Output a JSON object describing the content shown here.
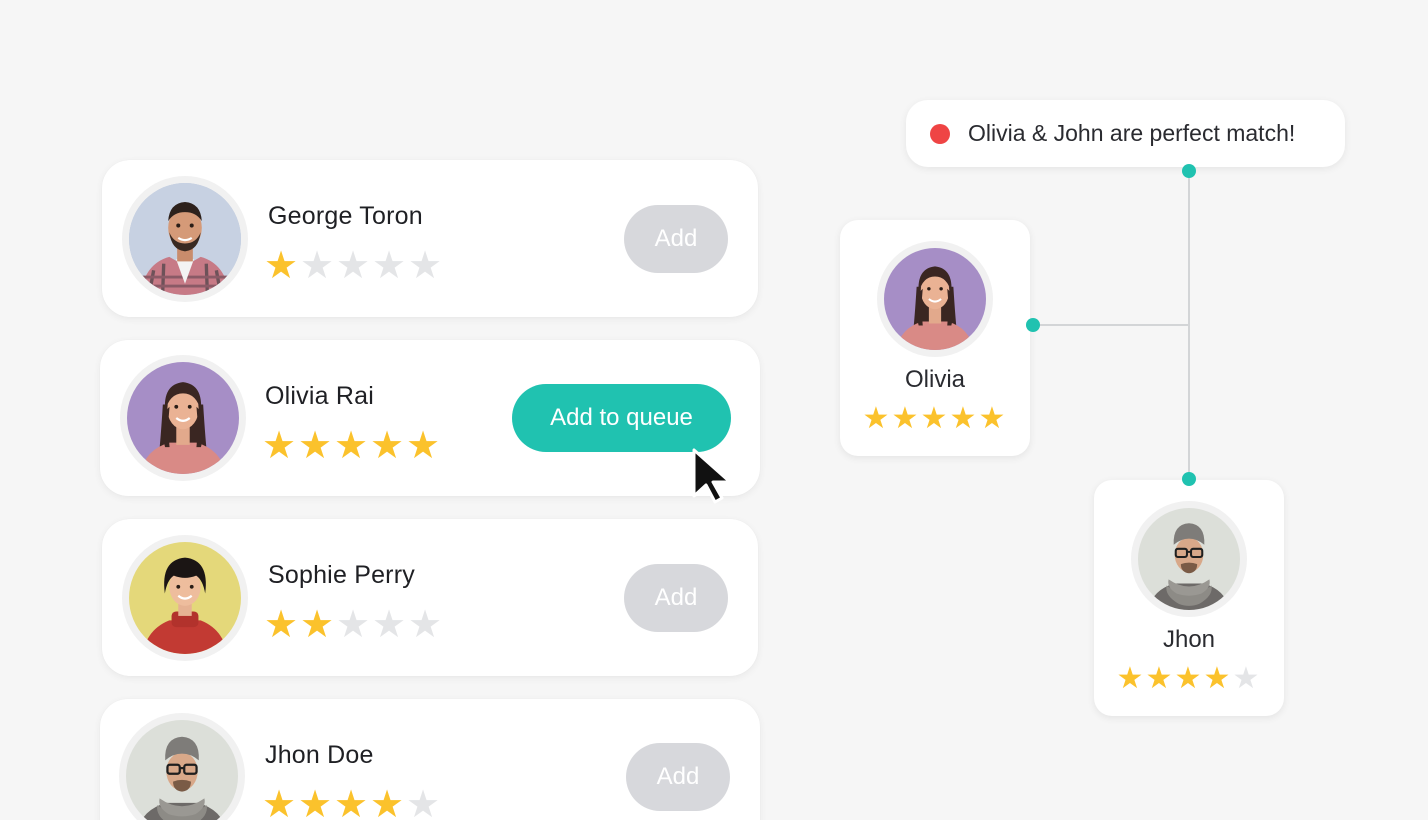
{
  "colors": {
    "accent": "#20c2b0",
    "star_filled": "#fbc22c",
    "star_empty": "#e4e5e7",
    "button_disabled": "#d7d8dc",
    "alert_dot": "#ef4444",
    "connector": "#20c2b0"
  },
  "people": [
    {
      "name": "George Toron",
      "rating": 1,
      "max_rating": 5,
      "button_label": "Add",
      "avatar": "man-beard-plaid-avatar"
    },
    {
      "name": "Olivia Rai",
      "rating": 5,
      "max_rating": 5,
      "button_label": "Add to queue",
      "avatar": "woman-long-hair-avatar"
    },
    {
      "name": "Sophie Perry",
      "rating": 2,
      "max_rating": 5,
      "button_label": "Add",
      "avatar": "woman-bob-hair-avatar"
    },
    {
      "name": "Jhon Doe",
      "rating": 4,
      "max_rating": 5,
      "button_label": "Add",
      "avatar": "man-glasses-beanie-avatar"
    }
  ],
  "match": {
    "message": "Olivia & John are perfect match!",
    "first": {
      "name": "Olivia",
      "rating": 5,
      "max_rating": 5
    },
    "second": {
      "name": "Jhon",
      "rating": 4,
      "max_rating": 5
    }
  }
}
